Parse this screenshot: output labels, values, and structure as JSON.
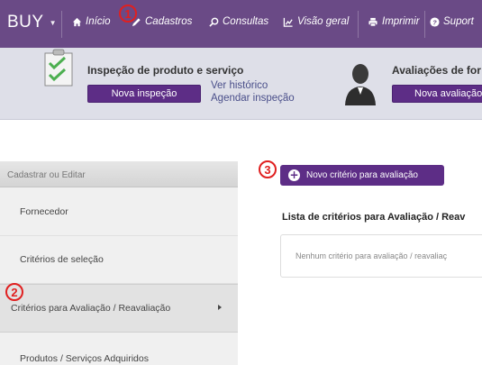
{
  "nav": {
    "brand": "BUY",
    "items": [
      {
        "label": "Início",
        "icon": "home-icon"
      },
      {
        "label": "Cadastros",
        "icon": "pencil-icon"
      },
      {
        "label": "Consultas",
        "icon": "search-icon"
      },
      {
        "label": "Visão geral",
        "icon": "chart-icon"
      },
      {
        "label": "Imprimir",
        "icon": "print-icon"
      },
      {
        "label": "Suport",
        "icon": "help-icon"
      }
    ]
  },
  "banner": {
    "inspection": {
      "title": "Inspeção de produto e serviço",
      "button": "Nova inspeção",
      "link_history": "Ver histórico",
      "link_schedule": "Agendar inspeção",
      "icon": "checklist-icon"
    },
    "evaluation": {
      "title": "Avaliações de for",
      "button": "Nova avaliação",
      "icon": "user-avatar-icon"
    }
  },
  "sidebar": {
    "header": "Cadastrar ou Editar",
    "items": [
      {
        "label": "Fornecedor"
      },
      {
        "label": "Critérios de seleção"
      },
      {
        "label": "Critérios para Avaliação / Reavaliação"
      },
      {
        "label": "Produtos / Serviços Adquiridos"
      }
    ],
    "active_index": 2
  },
  "main": {
    "new_criterion_button": "Novo critério para avaliação",
    "list_title": "Lista de critérios para Avaliação / Reav",
    "empty_message": "Nenhum critério para avaliação / reavaliaç"
  },
  "markers": [
    "1",
    "2",
    "3"
  ],
  "colors": {
    "nav_bg": "#6a4a86",
    "accent_purple": "#5d2d86",
    "marker_red": "#e02020",
    "banner_bg": "#dedfe8"
  }
}
